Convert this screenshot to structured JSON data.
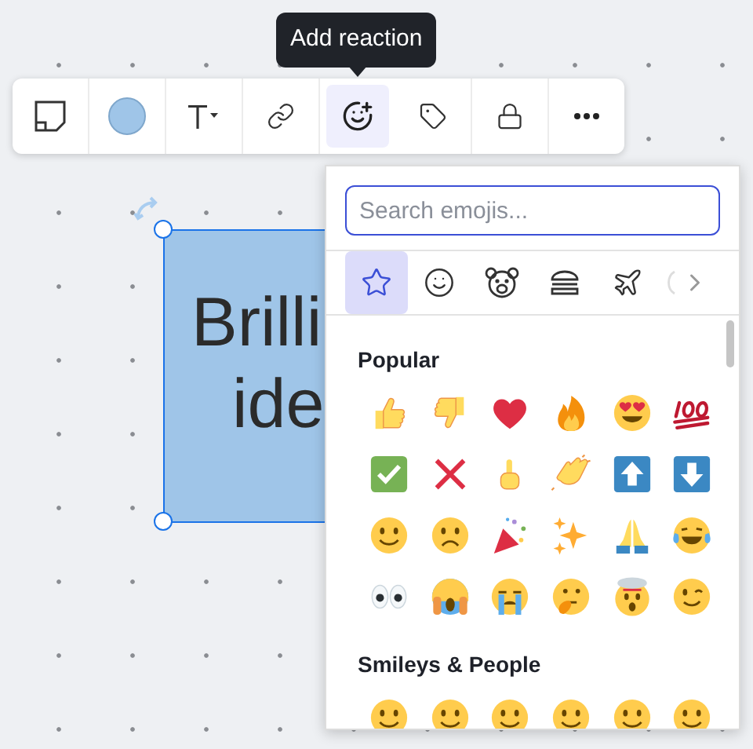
{
  "tooltip": {
    "text": "Add reaction"
  },
  "toolbar": [
    {
      "kind": "sticky",
      "selected": false
    },
    {
      "kind": "color",
      "selected": false
    },
    {
      "kind": "text",
      "selected": false
    },
    {
      "kind": "link",
      "selected": false
    },
    {
      "kind": "reaction",
      "selected": true
    },
    {
      "kind": "tag",
      "selected": false
    },
    {
      "kind": "lock",
      "selected": false
    },
    {
      "kind": "more",
      "selected": false
    }
  ],
  "sticky_note": {
    "lines": [
      "Brilli",
      "ide"
    ],
    "selected": true
  },
  "emoji_picker": {
    "search": {
      "placeholder": "Search emojis..."
    },
    "categories": [
      {
        "kind": "star",
        "selected": true
      },
      {
        "kind": "smiley",
        "selected": false
      },
      {
        "kind": "bear",
        "selected": false
      },
      {
        "kind": "burger",
        "selected": false
      },
      {
        "kind": "plane",
        "selected": false
      },
      {
        "kind": "faded",
        "selected": false
      }
    ],
    "sections": [
      {
        "title": "Popular",
        "items": [
          {
            "kind": "thumbs-up"
          },
          {
            "kind": "thumbs-down"
          },
          {
            "kind": "heart"
          },
          {
            "kind": "fire"
          },
          {
            "kind": "heart-eyes"
          },
          {
            "kind": "hundred"
          },
          {
            "kind": "check"
          },
          {
            "kind": "cross"
          },
          {
            "kind": "point-up"
          },
          {
            "kind": "clap"
          },
          {
            "kind": "arrow-up"
          },
          {
            "kind": "arrow-down"
          },
          {
            "kind": "smile"
          },
          {
            "kind": "frown"
          },
          {
            "kind": "party"
          },
          {
            "kind": "sparkles"
          },
          {
            "kind": "pray"
          },
          {
            "kind": "joy"
          },
          {
            "kind": "eyes"
          },
          {
            "kind": "scream"
          },
          {
            "kind": "sob"
          },
          {
            "kind": "thinking"
          },
          {
            "kind": "exploding"
          },
          {
            "kind": "wink"
          }
        ]
      },
      {
        "title": "Smileys & People",
        "items": [
          {
            "kind": "smile"
          },
          {
            "kind": "smile"
          },
          {
            "kind": "smile"
          },
          {
            "kind": "smile"
          },
          {
            "kind": "smile"
          },
          {
            "kind": "smile"
          }
        ]
      }
    ]
  }
}
